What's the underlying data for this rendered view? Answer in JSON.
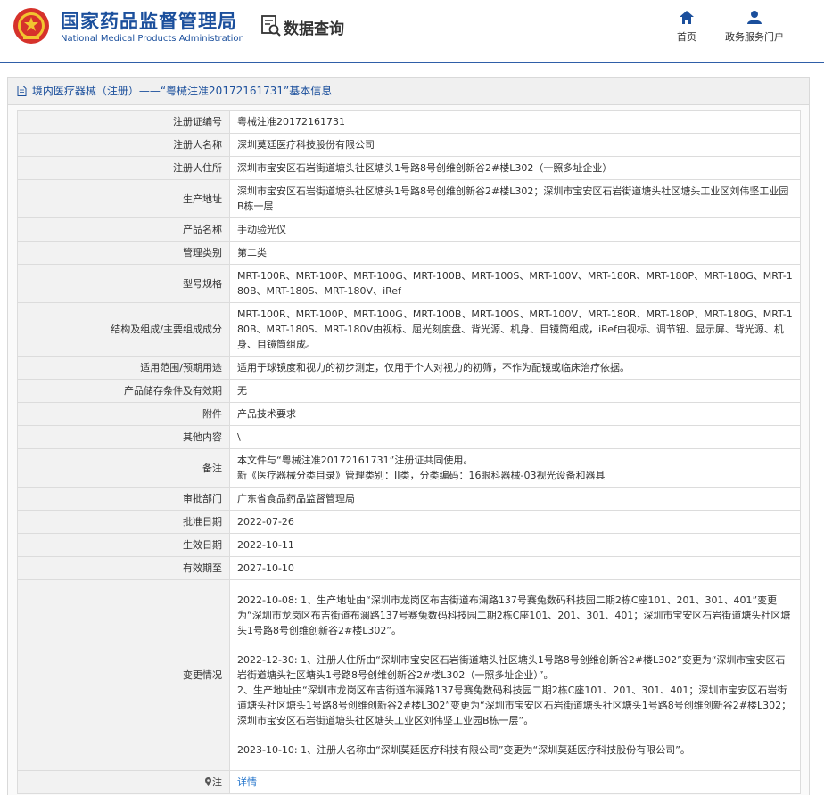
{
  "header": {
    "brand_cn": "国家药品监督管理局",
    "brand_en": "National Medical Products Administration",
    "query_title": "数据查询",
    "nav": {
      "home": "首页",
      "portal": "政务服务门户"
    },
    "accent": "#1b4f9c"
  },
  "panel": {
    "title": "境内医疗器械（注册）——“粤械注准20172161731”基本信息"
  },
  "rows": [
    {
      "label": "注册证编号",
      "value": "粤械注准20172161731"
    },
    {
      "label": "注册人名称",
      "value": "深圳莫廷医疗科技股份有限公司"
    },
    {
      "label": "注册人住所",
      "value": "深圳市宝安区石岩街道塘头社区塘头1号路8号创维创新谷2#楼L302（一照多址企业）"
    },
    {
      "label": "生产地址",
      "value": "深圳市宝安区石岩街道塘头社区塘头1号路8号创维创新谷2#楼L302；深圳市宝安区石岩街道塘头社区塘头工业区刘伟坚工业园B栋一层"
    },
    {
      "label": "产品名称",
      "value": "手动验光仪"
    },
    {
      "label": "管理类别",
      "value": "第二类"
    },
    {
      "label": "型号规格",
      "value": "MRT-100R、MRT-100P、MRT-100G、MRT-100B、MRT-100S、MRT-100V、MRT-180R、MRT-180P、MRT-180G、MRT-180B、MRT-180S、MRT-180V、iRef"
    },
    {
      "label": "结构及组成/主要组成成分",
      "value": "MRT-100R、MRT-100P、MRT-100G、MRT-100B、MRT-100S、MRT-100V、MRT-180R、MRT-180P、MRT-180G、MRT-180B、MRT-180S、MRT-180V由视标、屈光刻度盘、背光源、机身、目镜筒组成，iRef由视标、调节钮、显示屏、背光源、机身、目镜筒组成。"
    },
    {
      "label": "适用范围/预期用途",
      "value": "适用于球镜度和视力的初步测定，仅用于个人对视力的初筛，不作为配镜或临床治疗依据。"
    },
    {
      "label": "产品储存条件及有效期",
      "value": "无"
    },
    {
      "label": "附件",
      "value": "产品技术要求"
    },
    {
      "label": "其他内容",
      "value": "\\"
    },
    {
      "label": "备注",
      "value": "本文件与“粤械注准20172161731”注册证共同使用。",
      "value2": "新《医疗器械分类目录》管理类别：II类，分类编码：16眼科器械-03视光设备和器具"
    },
    {
      "label": "审批部门",
      "value": "广东省食品药品监督管理局"
    },
    {
      "label": "批准日期",
      "value": "2022-07-26"
    },
    {
      "label": "生效日期",
      "value": "2022-10-11"
    },
    {
      "label": "有效期至",
      "value": "2027-10-10"
    }
  ],
  "changes": {
    "label": "变更情况",
    "p1": "2022-10-08: 1、生产地址由“深圳市龙岗区布吉街道布澜路137号赛兔数码科技园二期2栋C座101、201、301、401”变更为“深圳市龙岗区布吉街道布澜路137号赛兔数码科技园二期2栋C座101、201、301、401；深圳市宝安区石岩街道塘头社区塘头1号路8号创维创新谷2#楼L302”。",
    "p2a": "2022-12-30: 1、注册人住所由“深圳市宝安区石岩街道塘头社区塘头1号路8号创维创新谷2#楼L302”变更为“深圳市宝安区石岩街道塘头社区塘头1号路8号创维创新谷2#楼L302（一照多址企业）”。",
    "p2b": "2、生产地址由“深圳市龙岗区布吉街道布澜路137号赛兔数码科技园二期2栋C座101、201、301、401；深圳市宝安区石岩街道塘头社区塘头1号路8号创维创新谷2#楼L302”变更为“深圳市宝安区石岩街道塘头社区塘头1号路8号创维创新谷2#楼L302；深圳市宝安区石岩街道塘头社区塘头工业区刘伟坚工业园B栋一层”。",
    "p3": "2023-10-10: 1、注册人名称由“深圳莫廷医疗科技有限公司”变更为“深圳莫廷医疗科技股份有限公司”。"
  },
  "note": {
    "label": "注",
    "link": "详情"
  }
}
